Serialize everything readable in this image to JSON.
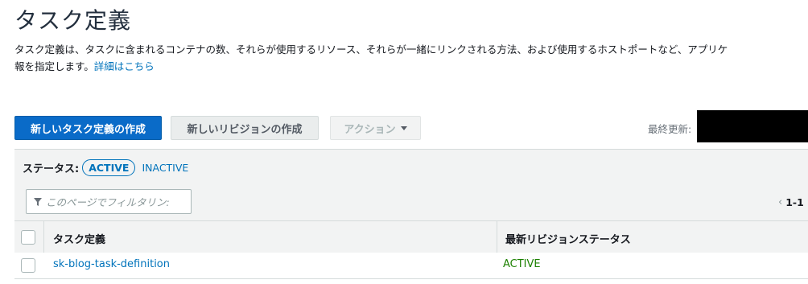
{
  "page": {
    "title": "タスク定義",
    "description_line1": "タスク定義は、タスクに含まれるコンテナの数、それらが使用するリソース、それらが一緒にリンクされる方法、および使用するホストポートなど、アプリケ",
    "description_line2": "報を指定します。",
    "details_link": "詳細はこちら"
  },
  "toolbar": {
    "create_new_label": "新しいタスク定義の作成",
    "create_revision_label": "新しいリビジョンの作成",
    "actions_label": "アクション",
    "last_updated_label": "最終更新:"
  },
  "status_filter": {
    "label": "ステータス:",
    "active": "ACTIVE",
    "inactive": "INACTIVE"
  },
  "filter": {
    "placeholder": "このページでフィルタリン:"
  },
  "pagination": {
    "range": "1-1",
    "prev_icon": "chevron-left-icon",
    "next_icon": "chevron-right-icon"
  },
  "table": {
    "columns": [
      "タスク定義",
      "最新リビジョンステータス"
    ],
    "rows": [
      {
        "name": "sk-blog-task-definition",
        "status": "ACTIVE"
      }
    ]
  },
  "colors": {
    "primary": "#0a6bc8",
    "link": "#0073bb",
    "active_status": "#1d8102",
    "panel_bg": "#f2f3f3"
  }
}
